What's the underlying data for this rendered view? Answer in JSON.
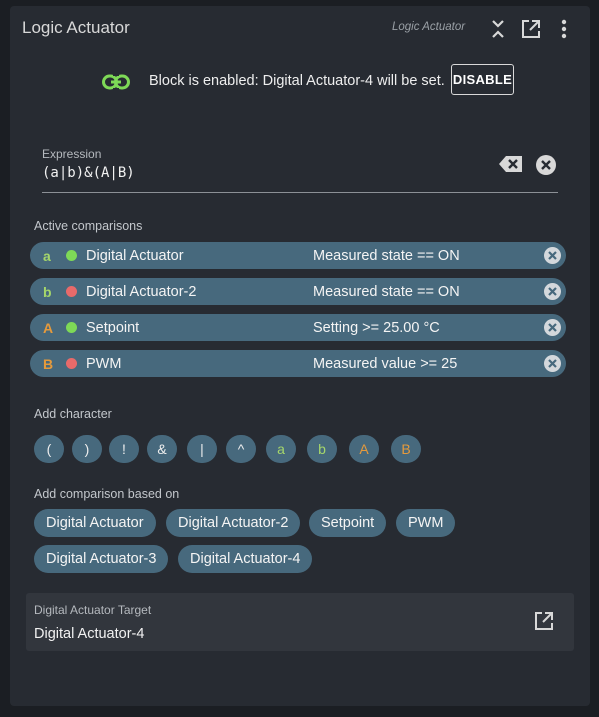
{
  "header": {
    "title": "Logic Actuator",
    "subtitle": "Logic Actuator",
    "icons": [
      "collapse-icon",
      "open-external-icon",
      "more-vert-icon"
    ]
  },
  "status": {
    "text": "Block is enabled: Digital Actuator-4 will be set.",
    "disable_label": "DISABLE",
    "link_color": "#7ed957"
  },
  "expression": {
    "label": "Expression",
    "value": "(a|b)&(A|B)"
  },
  "active_comparisons": {
    "label": "Active comparisons",
    "rows": [
      {
        "letter": "a",
        "letter_color": "#a5d66b",
        "state_color": "#7ed957",
        "name": "Digital Actuator",
        "condition": "Measured state == ON"
      },
      {
        "letter": "b",
        "letter_color": "#a5d66b",
        "state_color": "#e86a6a",
        "name": "Digital Actuator-2",
        "condition": "Measured state == ON"
      },
      {
        "letter": "A",
        "letter_color": "#e59a3c",
        "state_color": "#7ed957",
        "name": "Setpoint",
        "condition": "Setting >= 25.00 °C"
      },
      {
        "letter": "B",
        "letter_color": "#e59a3c",
        "state_color": "#e86a6a",
        "name": "PWM",
        "condition": "Measured value >= 25"
      }
    ]
  },
  "add_character": {
    "label": "Add character",
    "chars": [
      {
        "char": "(",
        "color": "#eeeeee"
      },
      {
        "char": ")",
        "color": "#eeeeee"
      },
      {
        "char": "!",
        "color": "#eeeeee"
      },
      {
        "char": "&",
        "color": "#eeeeee"
      },
      {
        "char": "|",
        "color": "#eeeeee"
      },
      {
        "char": "^",
        "color": "#eeeeee"
      },
      {
        "char": "a",
        "color": "#a5d66b"
      },
      {
        "char": "b",
        "color": "#a5d66b"
      },
      {
        "char": "A",
        "color": "#e59a3c"
      },
      {
        "char": "B",
        "color": "#e59a3c"
      }
    ]
  },
  "add_comparison": {
    "label": "Add comparison based on",
    "options": [
      "Digital Actuator",
      "Digital Actuator-2",
      "Setpoint",
      "PWM",
      "Digital Actuator-3",
      "Digital Actuator-4"
    ]
  },
  "target": {
    "label": "Digital Actuator Target",
    "value": "Digital Actuator-4"
  }
}
